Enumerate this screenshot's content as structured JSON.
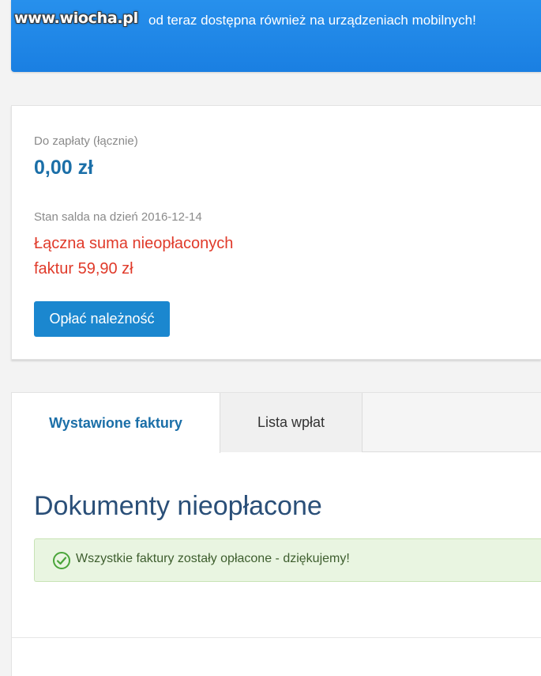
{
  "banner": {
    "watermark": "www.wiocha.pl",
    "text": "od teraz dostępna również na urządzeniach mobilnych!"
  },
  "summary": {
    "due_label": "Do zapłaty (łącznie)",
    "due_amount": "0,00 zł",
    "balance_label": "Stan salda na dzień 2016-12-14",
    "unpaid_notice": "Łączna suma nieopłaconych faktur 59,90 zł",
    "pay_button": "Opłać należność"
  },
  "tabs": [
    {
      "label": "Wystawione faktury",
      "active": true
    },
    {
      "label": "Lista wpłat",
      "active": false
    }
  ],
  "documents": {
    "title": "Dokumenty nieopłacone",
    "success_message": "Wszystkie faktury zostały opłacone - dziękujemy!",
    "success_icon": "check-circle-icon"
  },
  "colors": {
    "banner": "#1f86e8",
    "accent": "#1b6fa8",
    "alert": "#e03a2a",
    "button": "#1b87cf",
    "success_bg": "#e9f5e1"
  }
}
